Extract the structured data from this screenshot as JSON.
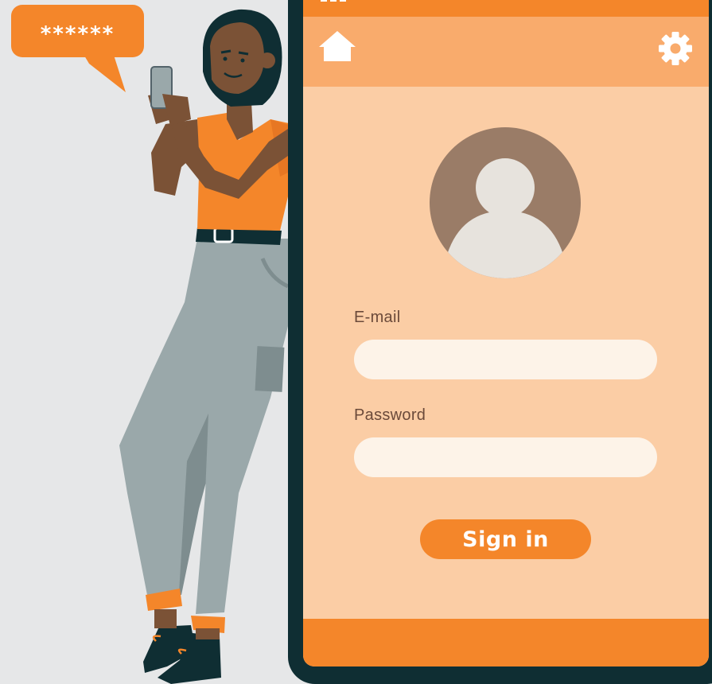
{
  "bubble": {
    "text": "******"
  },
  "nav": {
    "home_icon": "home-icon",
    "settings_icon": "gear-icon"
  },
  "profile": {
    "avatar_icon": "user-avatar-icon"
  },
  "form": {
    "email_label": "E-mail",
    "email_value": "",
    "password_label": "Password",
    "password_value": "",
    "sign_in_label": "Sign in"
  },
  "colors": {
    "background": "#e6e7e8",
    "accent_orange": "#f4862a",
    "nav_orange": "#f9ab6c",
    "screen_peach": "#fbcda5",
    "input_cream": "#fdf3e8",
    "avatar_brown": "#9a7c67",
    "phone_frame": "#0f2e33",
    "label_brown": "#6b4a3a"
  }
}
